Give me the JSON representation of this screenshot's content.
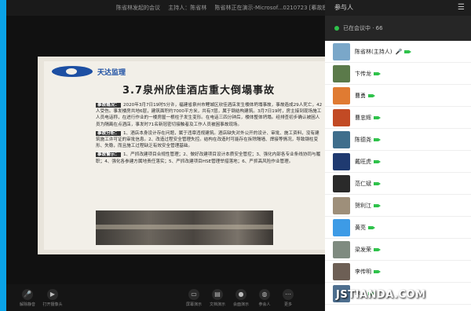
{
  "meeting": {
    "title": "陈省林发起的会议",
    "host": "主持人：陈省林",
    "sharing": "陈省林正在演示-Microsof...0210723 [事故模式]"
  },
  "slide": {
    "logo_text": "天达监理",
    "title": "3.7泉州欣佳酒店重大倒塌事故",
    "sections": [
      {
        "tag": "事故概况：",
        "text": "2020年3月7日19时5分许，福建省泉州市鲤城区欣佳酒店发生楼体坍塌事故，事故造成29人死亡，42人受伤。事发楼房共地6层，建筑面积约7000平方米，共有7层，属于钢结构建筑。3月7日19时，房主接到现场施工人员电话称，在进行作业的一楼房屋一根柱子发生变形。在电话三四分钟后，楼体整体坍塌。经排查初步确认被困人员为隔离在点酒店，事发时71名新冠密切接触者及工作人员被困事故现场。"
      },
      {
        "tag": "事故分析：",
        "text": "1、酒店本身设计存在问题，属于违章违规建筑。酒店缺失对外公开的设计、审批、施工资料，没有建筑施工许可证的审批信息。2、改造过程安全管理失控。结构在改造时可能存在拆除隔墙、焊接等情况，导致钢柱变形、失稳，而且施工过程缺乏有效安全管理基础。"
      },
      {
        "tag": "事故警示：",
        "text": "1、严抓改建项目合规性管理；2、做好改建项目设计本质安全管控；3、强化内部各专业条线协同与履职；4、强化各参建方属地责任落实；5、严抓改建项目HSE管理举措落地；6、严抓高风险作业管理。"
      }
    ]
  },
  "controls": [
    {
      "icon": "mic-icon",
      "glyph": "🎤",
      "label": "解除静音"
    },
    {
      "icon": "camera-icon",
      "glyph": "▶",
      "label": "打开摄像头"
    },
    {
      "icon": "screen-share-icon",
      "glyph": "▭",
      "label": "屏幕演示"
    },
    {
      "icon": "document-icon",
      "glyph": "▤",
      "label": "文档演示"
    },
    {
      "icon": "record-icon",
      "glyph": "●",
      "label": "会面演示"
    },
    {
      "icon": "participants-icon",
      "glyph": "◍",
      "label": "参会人"
    },
    {
      "icon": "more-icon",
      "glyph": "⋯",
      "label": "更多"
    }
  ],
  "panel": {
    "title": "参与人",
    "in_meeting": "已在会议中 · 66",
    "participants": [
      {
        "name": "陈省林(主持人)",
        "color": "#7aa7c9",
        "mic": true
      },
      {
        "name": "卞传龙",
        "color": "#5b7a4a",
        "mic": false
      },
      {
        "name": "曹勇",
        "color": "#e07b32",
        "mic": false
      },
      {
        "name": "曹忠辉",
        "color": "#c24a24",
        "mic": false
      },
      {
        "name": "陈德尧",
        "color": "#3f6e8c",
        "mic": false
      },
      {
        "name": "戴旺虎",
        "color": "#1f3a70",
        "mic": false
      },
      {
        "name": "范仁斌",
        "color": "#2a2a2a",
        "mic": false
      },
      {
        "name": "贺利江",
        "color": "#9e8f7a",
        "mic": false
      },
      {
        "name": "黄亮",
        "color": "#3d9be6",
        "mic": false
      },
      {
        "name": "梁发荣",
        "color": "#7f8b80",
        "mic": false
      },
      {
        "name": "李传明",
        "color": "#6d5f55",
        "mic": false
      },
      {
        "name": "李…",
        "color": "#4e6f8f",
        "mic": false
      }
    ]
  },
  "watermark": "JSTIANDA.COM"
}
